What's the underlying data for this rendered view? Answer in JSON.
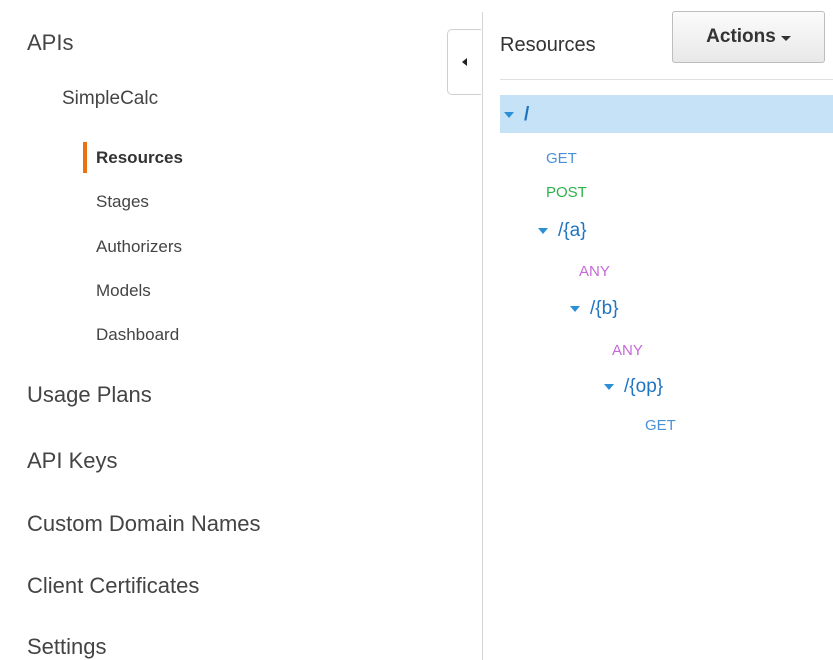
{
  "nav": {
    "apis": "APIs",
    "api_name": "SimpleCalc",
    "sub_items": {
      "resources": "Resources",
      "stages": "Stages",
      "authorizers": "Authorizers",
      "models": "Models",
      "dashboard": "Dashboard"
    },
    "usage_plans": "Usage Plans",
    "api_keys": "API Keys",
    "custom_domain_names": "Custom Domain Names",
    "client_certificates": "Client Certificates",
    "settings": "Settings",
    "active_item": "Resources",
    "accent_color": "#ec7211"
  },
  "resources_panel": {
    "header": "Resources",
    "actions_button": "Actions",
    "selected_color": "#c5e2f7",
    "tree": {
      "root_path": "/",
      "root_get": "GET",
      "root_post": "POST",
      "a_path": "/{a}",
      "a_any": "ANY",
      "b_path": "/{b}",
      "b_any": "ANY",
      "op_path": "/{op}",
      "op_get": "GET"
    },
    "method_colors": {
      "GET": "#4a90d9",
      "POST": "#2db24a",
      "ANY": "#c668d8"
    }
  },
  "icons": [
    "caret-left-icon",
    "caret-down-icon",
    "tree-expand-icon"
  ]
}
